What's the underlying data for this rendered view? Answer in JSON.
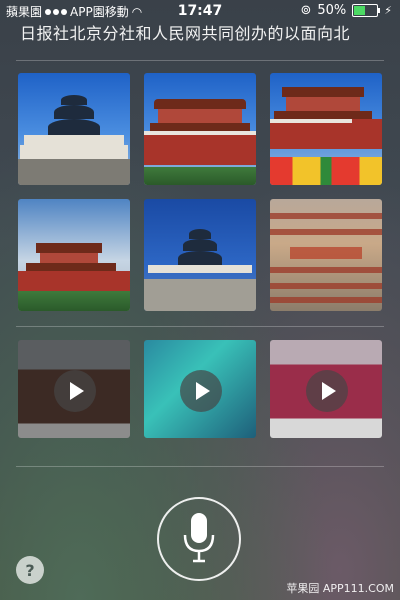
{
  "status": {
    "carrier": "APP園移動",
    "watermark_top": "蘋果園",
    "time": "17:47",
    "battery_text": "50%",
    "battery_level": 0.5
  },
  "siri": {
    "transcript": "日报社北京分社和人民网共同创办的以面向北"
  },
  "media": {
    "images": [
      {
        "icon": "temple-of-heaven-photo"
      },
      {
        "icon": "tiananmen-gate-photo"
      },
      {
        "icon": "tiananmen-flowers-photo"
      },
      {
        "icon": "tiananmen-clouds-photo"
      },
      {
        "icon": "temple-of-heaven-photo"
      },
      {
        "icon": "forbidden-city-aerial-photo"
      }
    ],
    "videos": [
      {
        "icon": "video-thumbnail"
      },
      {
        "icon": "video-thumbnail"
      },
      {
        "icon": "video-thumbnail"
      }
    ]
  },
  "controls": {
    "help_label": "?",
    "mic_icon": "microphone-icon"
  },
  "watermark_bottom": "苹果园  APP111.COM",
  "colors": {
    "battery_green": "#4cd964",
    "accent_white": "#ffffff"
  }
}
